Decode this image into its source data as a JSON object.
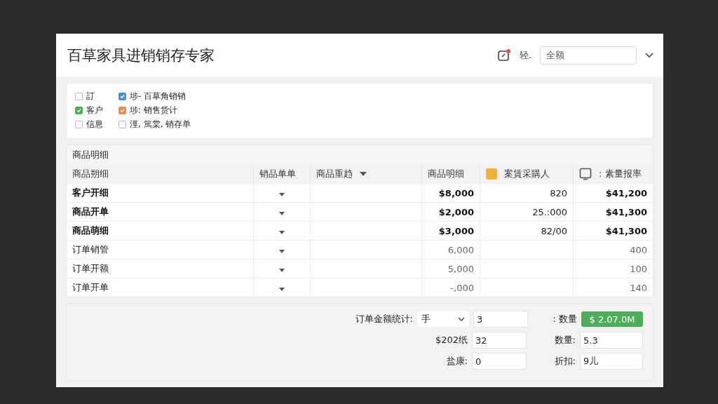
{
  "header": {
    "title": "百草家具进销销存专家",
    "user_label": "轻.",
    "select": {
      "value": "全额"
    }
  },
  "legend": [
    {
      "label": "訂",
      "checked": false
    },
    {
      "label": "客户",
      "checked": true,
      "color": "#4caf50"
    },
    {
      "label": "信息",
      "checked": false
    },
    {
      "label": "埗- 百草角销销",
      "checked": true,
      "color": "#4a90d9"
    },
    {
      "label": "埗: 销售货计",
      "checked": true,
      "color": "#f08a4b"
    },
    {
      "label": "涇, 篤棠, 销存单",
      "checked": false
    }
  ],
  "table": {
    "title": "商品明细",
    "columns": [
      {
        "label": "商品朔细",
        "kind": "text"
      },
      {
        "label": "销品单单",
        "kind": "text"
      },
      {
        "label": "商品重趋",
        "kind": "dropdown"
      },
      {
        "label": "商品明细",
        "kind": "text"
      },
      {
        "label": "案賃采購人",
        "kind": "badge"
      },
      {
        "label": ": 素量报率",
        "kind": "tablet"
      }
    ],
    "rows": [
      {
        "name": "客户开细",
        "bold": true,
        "amount": "$8,000",
        "buyer": "820",
        "rate": "$41,200"
      },
      {
        "name": "商品开单",
        "bold": true,
        "amount": "$2,000",
        "buyer": "25.:000",
        "rate": "$41,300"
      },
      {
        "name": "商品萌细",
        "bold": true,
        "amount": "$3,000",
        "buyer": "82/00",
        "rate": "$41,300"
      },
      {
        "name": "订单销管",
        "bold": false,
        "amount": "6,000",
        "buyer": "",
        "rate": "400"
      },
      {
        "name": "订单开额",
        "bold": false,
        "amount": "5,000",
        "buyer": "",
        "rate": "100"
      },
      {
        "name": "订单开单",
        "bold": false,
        "amount": "-,000",
        "buyer": "",
        "rate": "140"
      }
    ]
  },
  "summary": [
    {
      "label": "订单金额统计:",
      "select": "手",
      "field": "3",
      "label2": ": 数量",
      "kind": "badge",
      "value2": "$ 2.07.0M"
    },
    {
      "label": "$202纸",
      "field": "32",
      "label2": "数量:",
      "kind": "field",
      "value2": "5.3"
    },
    {
      "label": "盐康:",
      "field": "0",
      "label2": "折扣:",
      "kind": "field",
      "value2": "9儿"
    }
  ]
}
